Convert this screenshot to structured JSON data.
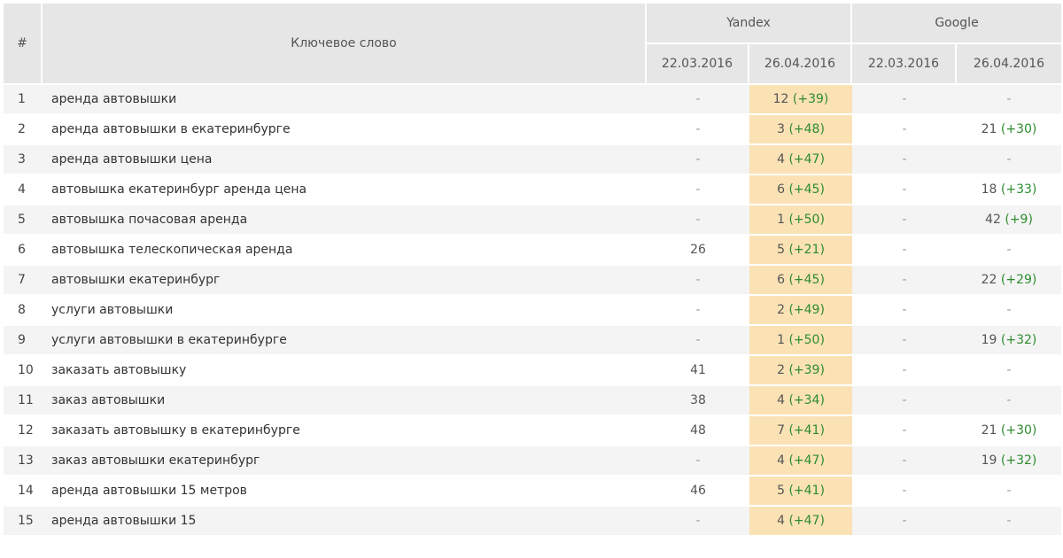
{
  "header": {
    "num": "#",
    "keyword": "Ключевое слово",
    "yandex": "Yandex",
    "google": "Google",
    "dates": [
      "22.03.2016",
      "26.04.2016",
      "22.03.2016",
      "26.04.2016"
    ]
  },
  "rows": [
    {
      "n": "1",
      "kw": "аренда автовышки",
      "y1": "-",
      "y2": "12",
      "y2d": "(+39)",
      "g1": "-",
      "g2": "-",
      "g2d": ""
    },
    {
      "n": "2",
      "kw": "аренда автовышки в екатеринбурге",
      "y1": "-",
      "y2": "3",
      "y2d": "(+48)",
      "g1": "-",
      "g2": "21",
      "g2d": "(+30)"
    },
    {
      "n": "3",
      "kw": "аренда автовышки цена",
      "y1": "-",
      "y2": "4",
      "y2d": "(+47)",
      "g1": "-",
      "g2": "-",
      "g2d": ""
    },
    {
      "n": "4",
      "kw": "автовышка екатеринбург аренда цена",
      "y1": "-",
      "y2": "6",
      "y2d": "(+45)",
      "g1": "-",
      "g2": "18",
      "g2d": "(+33)"
    },
    {
      "n": "5",
      "kw": "автовышка почасовая аренда",
      "y1": "-",
      "y2": "1",
      "y2d": "(+50)",
      "g1": "-",
      "g2": "42",
      "g2d": "(+9)"
    },
    {
      "n": "6",
      "kw": "автовышка телескопическая аренда",
      "y1": "26",
      "y2": "5",
      "y2d": "(+21)",
      "g1": "-",
      "g2": "-",
      "g2d": ""
    },
    {
      "n": "7",
      "kw": "автовышки екатеринбург",
      "y1": "-",
      "y2": "6",
      "y2d": "(+45)",
      "g1": "-",
      "g2": "22",
      "g2d": "(+29)"
    },
    {
      "n": "8",
      "kw": "услуги автовышки",
      "y1": "-",
      "y2": "2",
      "y2d": "(+49)",
      "g1": "-",
      "g2": "-",
      "g2d": ""
    },
    {
      "n": "9",
      "kw": "услуги автовышки в екатеринбурге",
      "y1": "-",
      "y2": "1",
      "y2d": "(+50)",
      "g1": "-",
      "g2": "19",
      "g2d": "(+32)"
    },
    {
      "n": "10",
      "kw": "заказать автовышку",
      "y1": "41",
      "y2": "2",
      "y2d": "(+39)",
      "g1": "-",
      "g2": "-",
      "g2d": ""
    },
    {
      "n": "11",
      "kw": "заказ автовышки",
      "y1": "38",
      "y2": "4",
      "y2d": "(+34)",
      "g1": "-",
      "g2": "-",
      "g2d": ""
    },
    {
      "n": "12",
      "kw": "заказать автовышку в екатеринбурге",
      "y1": "48",
      "y2": "7",
      "y2d": "(+41)",
      "g1": "-",
      "g2": "21",
      "g2d": "(+30)"
    },
    {
      "n": "13",
      "kw": "заказ автовышки екатеринбург",
      "y1": "-",
      "y2": "4",
      "y2d": "(+47)",
      "g1": "-",
      "g2": "19",
      "g2d": "(+32)"
    },
    {
      "n": "14",
      "kw": "аренда автовышки 15 метров",
      "y1": "46",
      "y2": "5",
      "y2d": "(+41)",
      "g1": "-",
      "g2": "-",
      "g2d": ""
    },
    {
      "n": "15",
      "kw": "аренда автовышки 15",
      "y1": "-",
      "y2": "4",
      "y2d": "(+47)",
      "g1": "-",
      "g2": "-",
      "g2d": ""
    }
  ],
  "colors": {
    "header_bg": "#e6e6e6",
    "row_alt_bg": "#f4f4f4",
    "highlight_bg": "#fbe2b5",
    "delta_green": "#2e8b2e"
  }
}
